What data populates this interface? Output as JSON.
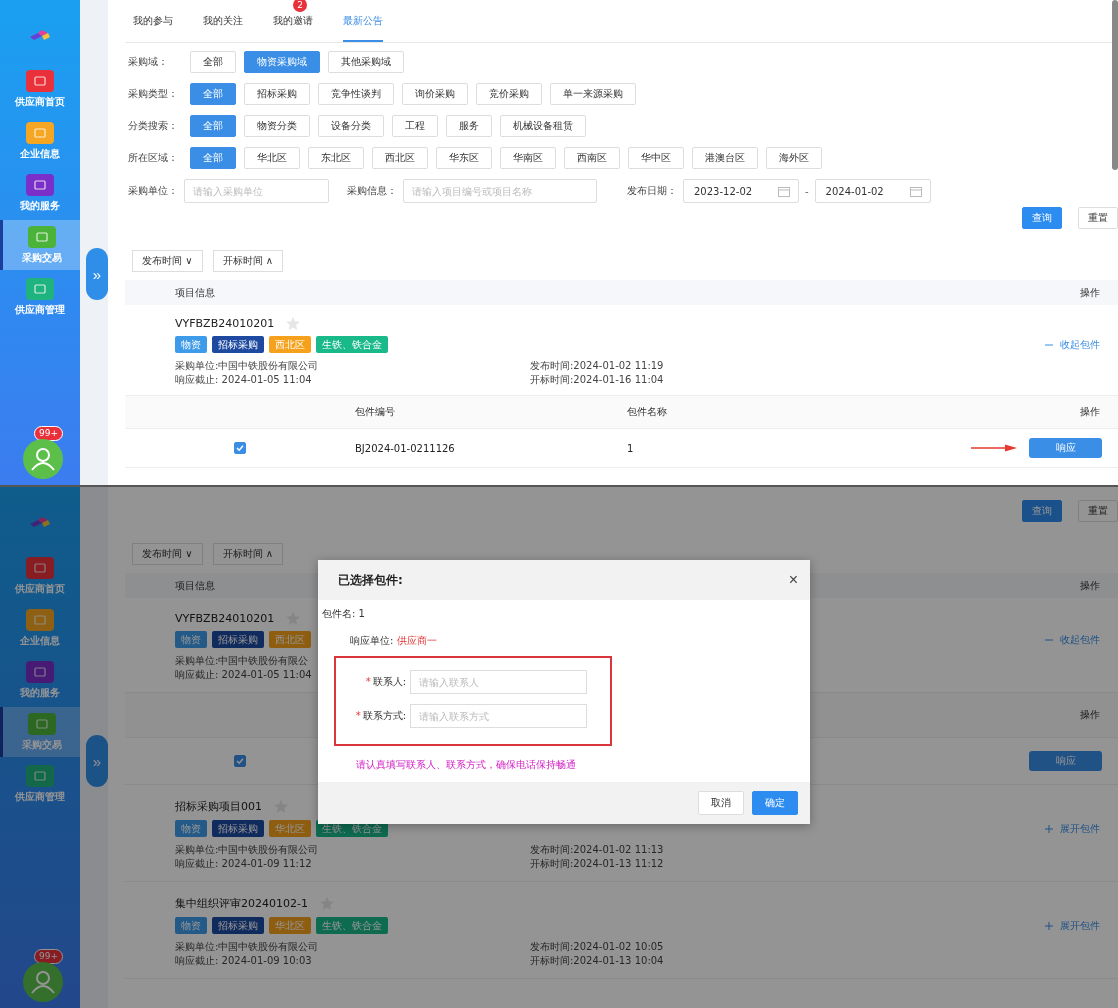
{
  "screens": [
    {
      "kind": "list",
      "sidebar": {
        "items": [
          {
            "label": "供应商首页",
            "kind": "home",
            "selected": false
          },
          {
            "label": "企业信息",
            "kind": "company",
            "selected": false
          },
          {
            "label": "我的服务",
            "kind": "service",
            "selected": false
          },
          {
            "label": "采购交易",
            "kind": "trade",
            "selected": true
          },
          {
            "label": "供应商管理",
            "kind": "supplier",
            "selected": false
          }
        ],
        "badge": "99+",
        "toggle": "»"
      },
      "tabs": [
        {
          "label": "我的参与",
          "selected": false
        },
        {
          "label": "我的关注",
          "selected": false
        },
        {
          "label": "我的邀请",
          "selected": false,
          "badge": "2"
        },
        {
          "label": "最新公告",
          "selected": true
        }
      ],
      "filters": [
        {
          "label": "采购域：",
          "options": [
            {
              "label": "全部",
              "selected": false
            },
            {
              "label": "物资采购域",
              "selected": true
            },
            {
              "label": "其他采购域",
              "selected": false
            }
          ]
        },
        {
          "label": "采购类型：",
          "options": [
            {
              "label": "全部",
              "selected": true
            },
            {
              "label": "招标采购",
              "selected": false
            },
            {
              "label": "竞争性谈判",
              "selected": false
            },
            {
              "label": "询价采购",
              "selected": false
            },
            {
              "label": "竞价采购",
              "selected": false
            },
            {
              "label": "单一来源采购",
              "selected": false
            }
          ]
        },
        {
          "label": "分类搜索：",
          "options": [
            {
              "label": "全部",
              "selected": true
            },
            {
              "label": "物资分类",
              "selected": false
            },
            {
              "label": "设备分类",
              "selected": false
            },
            {
              "label": "工程",
              "selected": false
            },
            {
              "label": "服务",
              "selected": false
            },
            {
              "label": "机械设备租赁",
              "selected": false
            }
          ]
        },
        {
          "label": "所在区域：",
          "options": [
            {
              "label": "全部",
              "selected": true
            },
            {
              "label": "华北区",
              "selected": false
            },
            {
              "label": "东北区",
              "selected": false
            },
            {
              "label": "西北区",
              "selected": false
            },
            {
              "label": "华东区",
              "selected": false
            },
            {
              "label": "华南区",
              "selected": false
            },
            {
              "label": "西南区",
              "selected": false
            },
            {
              "label": "华中区",
              "selected": false
            },
            {
              "label": "港澳台区",
              "selected": false
            },
            {
              "label": "海外区",
              "selected": false
            }
          ]
        }
      ],
      "search": {
        "fields": [
          {
            "label": "采购单位：",
            "placeholder": "请输入采购单位"
          },
          {
            "label": "采购信息：",
            "placeholder": "请输入项目编号或项目名称"
          }
        ],
        "date_label": "发布日期：",
        "date_from": "2023-12-02",
        "separator": "-",
        "date_to": "2024-01-02"
      },
      "buttons": [
        {
          "label": "查询",
          "kind": "primary"
        },
        {
          "label": "重置",
          "kind": "default"
        }
      ],
      "sorts": [
        {
          "label": "发布时间",
          "arrow": "∨"
        },
        {
          "label": "开标时间",
          "arrow": "∧"
        }
      ],
      "table": {
        "columns": [
          "项目信息",
          "操作"
        ]
      },
      "projects": [
        {
          "title": "VYFBZB24010201",
          "starred": false,
          "tags": [
            {
              "label": "物资",
              "kind": "material"
            },
            {
              "label": "招标采购",
              "kind": "method"
            },
            {
              "label": "西北区",
              "kind": "region"
            },
            {
              "label": "生铁、铁合金",
              "kind": "category"
            }
          ],
          "unit": "采购单位:中国中铁股份有限公司",
          "deadline": "响应截止: 2024-01-05 11:04",
          "published": "发布时间:2024-01-02 11:19",
          "opening": "开标时间:2024-01-16 11:04",
          "toggle": "收起包件",
          "expanded": true,
          "packages": {
            "columns": [
              {
                "kind": "number",
                "label": "包件编号"
              },
              {
                "kind": "name",
                "label": "包件名称"
              },
              {
                "kind": "action",
                "label": "操作"
              }
            ],
            "rows": [
              {
                "checked": true,
                "number": "BJ2024-01-0211126",
                "name": "1",
                "action": "响应",
                "annotated": true
              }
            ]
          }
        }
      ]
    },
    {
      "kind": "dialog",
      "sidebar": {
        "items": [
          {
            "label": "供应商首页",
            "kind": "home",
            "selected": false
          },
          {
            "label": "企业信息",
            "kind": "company",
            "selected": false
          },
          {
            "label": "我的服务",
            "kind": "service",
            "selected": false
          },
          {
            "label": "采购交易",
            "kind": "trade",
            "selected": true
          },
          {
            "label": "供应商管理",
            "kind": "supplier",
            "selected": false
          }
        ],
        "badge": "99+",
        "toggle": "»"
      },
      "buttons": [
        {
          "label": "查询",
          "kind": "primary"
        },
        {
          "label": "重置",
          "kind": "default"
        }
      ],
      "sorts": [
        {
          "label": "发布时间",
          "arrow": "∨"
        },
        {
          "label": "开标时间",
          "arrow": "∧"
        }
      ],
      "table": {
        "columns": [
          "项目信息",
          "操作"
        ]
      },
      "projects": [
        {
          "title": "VYFBZB24010201",
          "starred": false,
          "tags": [
            {
              "label": "物资",
              "kind": "material"
            },
            {
              "label": "招标采购",
              "kind": "method"
            },
            {
              "label": "西北区",
              "kind": "region"
            }
          ],
          "unit": "采购单位:中国中铁股份有限公",
          "deadline": "响应截止: 2024-01-05 11:04",
          "toggle": "收起包件",
          "expanded": true,
          "packages": {
            "columns": [
              {
                "kind": "action",
                "label": "操作"
              }
            ],
            "rows": [
              {
                "checked": true,
                "action": "响应",
                "annotated": false
              }
            ]
          }
        },
        {
          "title": "招标采购项目001",
          "starred": false,
          "tags": [
            {
              "label": "物资",
              "kind": "material"
            },
            {
              "label": "招标采购",
              "kind": "method"
            },
            {
              "label": "华北区",
              "kind": "region"
            },
            {
              "label": "生铁、铁合金",
              "kind": "category"
            }
          ],
          "unit": "采购单位:中国中铁股份有限公司",
          "deadline": "响应截止: 2024-01-09 11:12",
          "published": "发布时间:2024-01-02 11:13",
          "opening": "开标时间:2024-01-13 11:12",
          "toggle": "展开包件",
          "expanded": false
        },
        {
          "title": "集中组织评审20240102-1",
          "starred": false,
          "tags": [
            {
              "label": "物资",
              "kind": "material"
            },
            {
              "label": "招标采购",
              "kind": "method"
            },
            {
              "label": "华北区",
              "kind": "region"
            },
            {
              "label": "生铁、铁合金",
              "kind": "category"
            }
          ],
          "unit": "采购单位:中国中铁股份有限公司",
          "deadline": "响应截止: 2024-01-09 10:03",
          "published": "发布时间:2024-01-02 10:05",
          "opening": "开标时间:2024-01-13 10:04",
          "toggle": "展开包件",
          "expanded": false
        }
      ],
      "dialog": {
        "title": "已选择包件:",
        "close": "×",
        "package": "包件名: 1",
        "unit_label": "响应单位:",
        "unit_value": "供应商一",
        "fields": [
          {
            "mark": "*",
            "label": "联系人:",
            "placeholder": "请输入联系人"
          },
          {
            "mark": "*",
            "label": "联系方式:",
            "placeholder": "请输入联系方式"
          }
        ],
        "note": "请认真填写联系人、联系方式，确保电话保持畅通",
        "buttons": [
          {
            "label": "取消",
            "kind": "default"
          },
          {
            "label": "确定",
            "kind": "primary"
          }
        ]
      }
    }
  ]
}
